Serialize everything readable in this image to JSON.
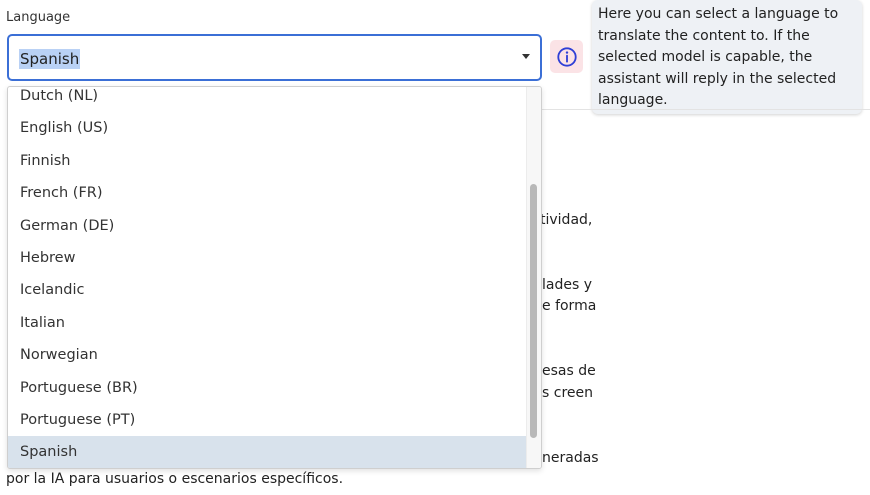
{
  "language": {
    "label": "Language",
    "selected": "Spanish",
    "options": [
      "Dutch (NL)",
      "English (US)",
      "Finnish",
      "French (FR)",
      "German (DE)",
      "Hebrew",
      "Icelandic",
      "Italian",
      "Norwegian",
      "Portuguese (BR)",
      "Portuguese (PT)",
      "Spanish"
    ]
  },
  "info": {
    "icon": "info-icon",
    "tooltip": "Here you can select a language to translate the content to. If the selected model is capable, the assistant will reply in the selected language."
  },
  "background_text": {
    "frag1": "tividad,",
    "frag2": "lades y",
    "frag3": "e forma",
    "frag4": "esas de",
    "frag5": "s creen",
    "frag6": "neradas",
    "last_line": "por la IA para usuarios o escenarios específicos."
  },
  "colors": {
    "focus_border": "#3b6fd6",
    "selection_highlight": "#b9d1f5",
    "info_bg": "#fbe3e6",
    "info_icon": "#2f3fd6",
    "selected_option_bg": "#d8e2ec",
    "tooltip_bg": "#eef1f5"
  }
}
